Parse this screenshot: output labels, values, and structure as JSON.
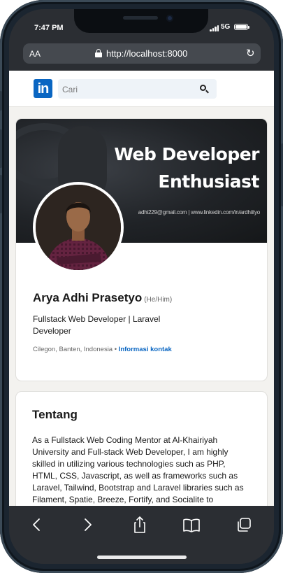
{
  "status_bar": {
    "time": "7:47 PM",
    "network": "5G"
  },
  "browser": {
    "text_size_label": "AA",
    "url": "http://localhost:8000",
    "reload_icon": "reload-icon"
  },
  "linkedin": {
    "logo_text": "in",
    "brand_color": "#0a66c2",
    "search": {
      "placeholder": "Cari"
    }
  },
  "profile": {
    "banner": {
      "title_line1": "Web Developer",
      "title_line2": "Enthusiast",
      "contact": "adhi229@gmail.com | www.linkedin.com/in/ardhiityo"
    },
    "name": "Arya Adhi Prasetyo",
    "pronouns": "(He/Him)",
    "headline": "Fullstack Web Developer | Laravel Developer",
    "location": "Cilegon, Banten, Indonesia",
    "separator": " • ",
    "contact_info_link": "Informasi kontak"
  },
  "about": {
    "title": "Tentang",
    "text": "As a Fullstack Web Coding Mentor at Al-Khairiyah University and Full-stack Web Developer, I am highly skilled in utilizing various technologies such as PHP, HTML, CSS, Javascript, as well as frameworks such as Laravel, Tailwind, Bootstrap and Laravel libraries such as Filament, Spatie, Breeze, Fortify, and Socialite to"
  },
  "toolbar": {
    "icons": [
      "back-icon",
      "forward-icon",
      "share-icon",
      "bookmarks-icon",
      "tabs-icon"
    ]
  }
}
